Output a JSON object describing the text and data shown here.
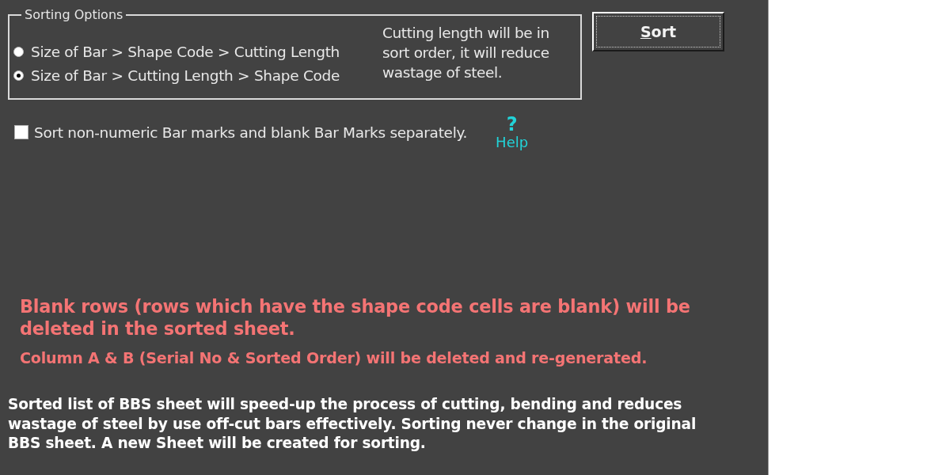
{
  "sorting_options": {
    "title": "Sorting Options",
    "options": [
      {
        "label": "Size of Bar > Shape Code > Cutting Length",
        "selected": false
      },
      {
        "label": "Size of Bar > Cutting Length > Shape Code",
        "selected": true
      }
    ],
    "description": "Cutting length will be in sort order, it will reduce wastage of steel."
  },
  "sort_button": {
    "label": "Sort",
    "access_key_underlined": true,
    "focused": true
  },
  "separate_option": {
    "label": "Sort non-numeric Bar marks and blank Bar Marks separately.",
    "checked": false
  },
  "help": {
    "icon": "?",
    "label": "Help"
  },
  "warnings": [
    {
      "kind": "major",
      "text": "Blank rows (rows which have the shape code cells are blank) will be deleted in the sorted sheet."
    },
    {
      "kind": "minor",
      "text": "Column A & B (Serial No & Sorted Order) will be deleted and re-generated."
    }
  ],
  "note": "Sorted list of BBS sheet will speed-up the process of cutting, bending and reduces wastage of steel by use off-cut bars effectively. Sorting never change in the original BBS sheet. A new Sheet will be created for sorting."
}
